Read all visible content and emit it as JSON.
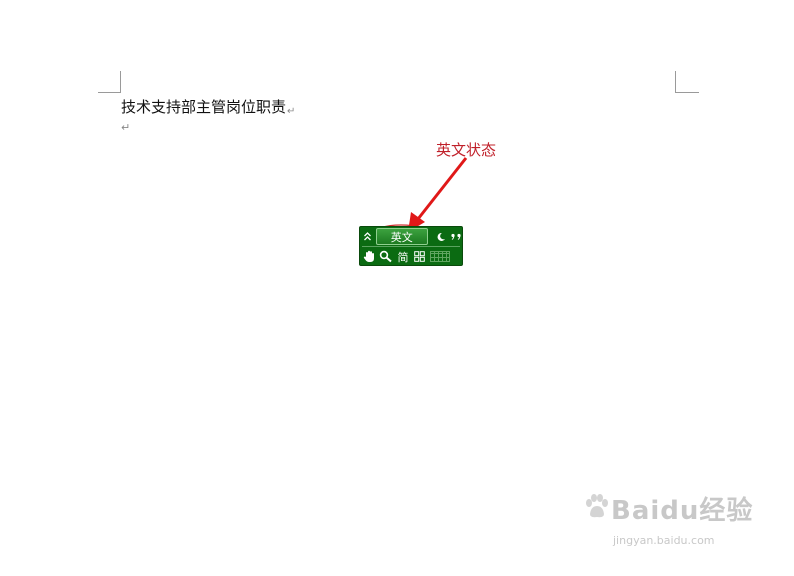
{
  "document": {
    "line1": "技术支持部主管岗位职责",
    "paragraph_mark": "↵"
  },
  "annotation": {
    "label": "英文状态",
    "color": "#c0202a"
  },
  "ime_toolbar": {
    "collapse_glyph": "«",
    "mode_label": "英文",
    "fullhalf_glyph": "☽",
    "punct_glyph": "‘,",
    "softkbd_glyph": "✋",
    "search_glyph": "🔍",
    "simplified_label": "简",
    "skin_glyph": "器",
    "bar_color": "#0b6b12"
  },
  "watermark": {
    "main": "Baidu经验",
    "sub": "jingyan.baidu.com"
  }
}
